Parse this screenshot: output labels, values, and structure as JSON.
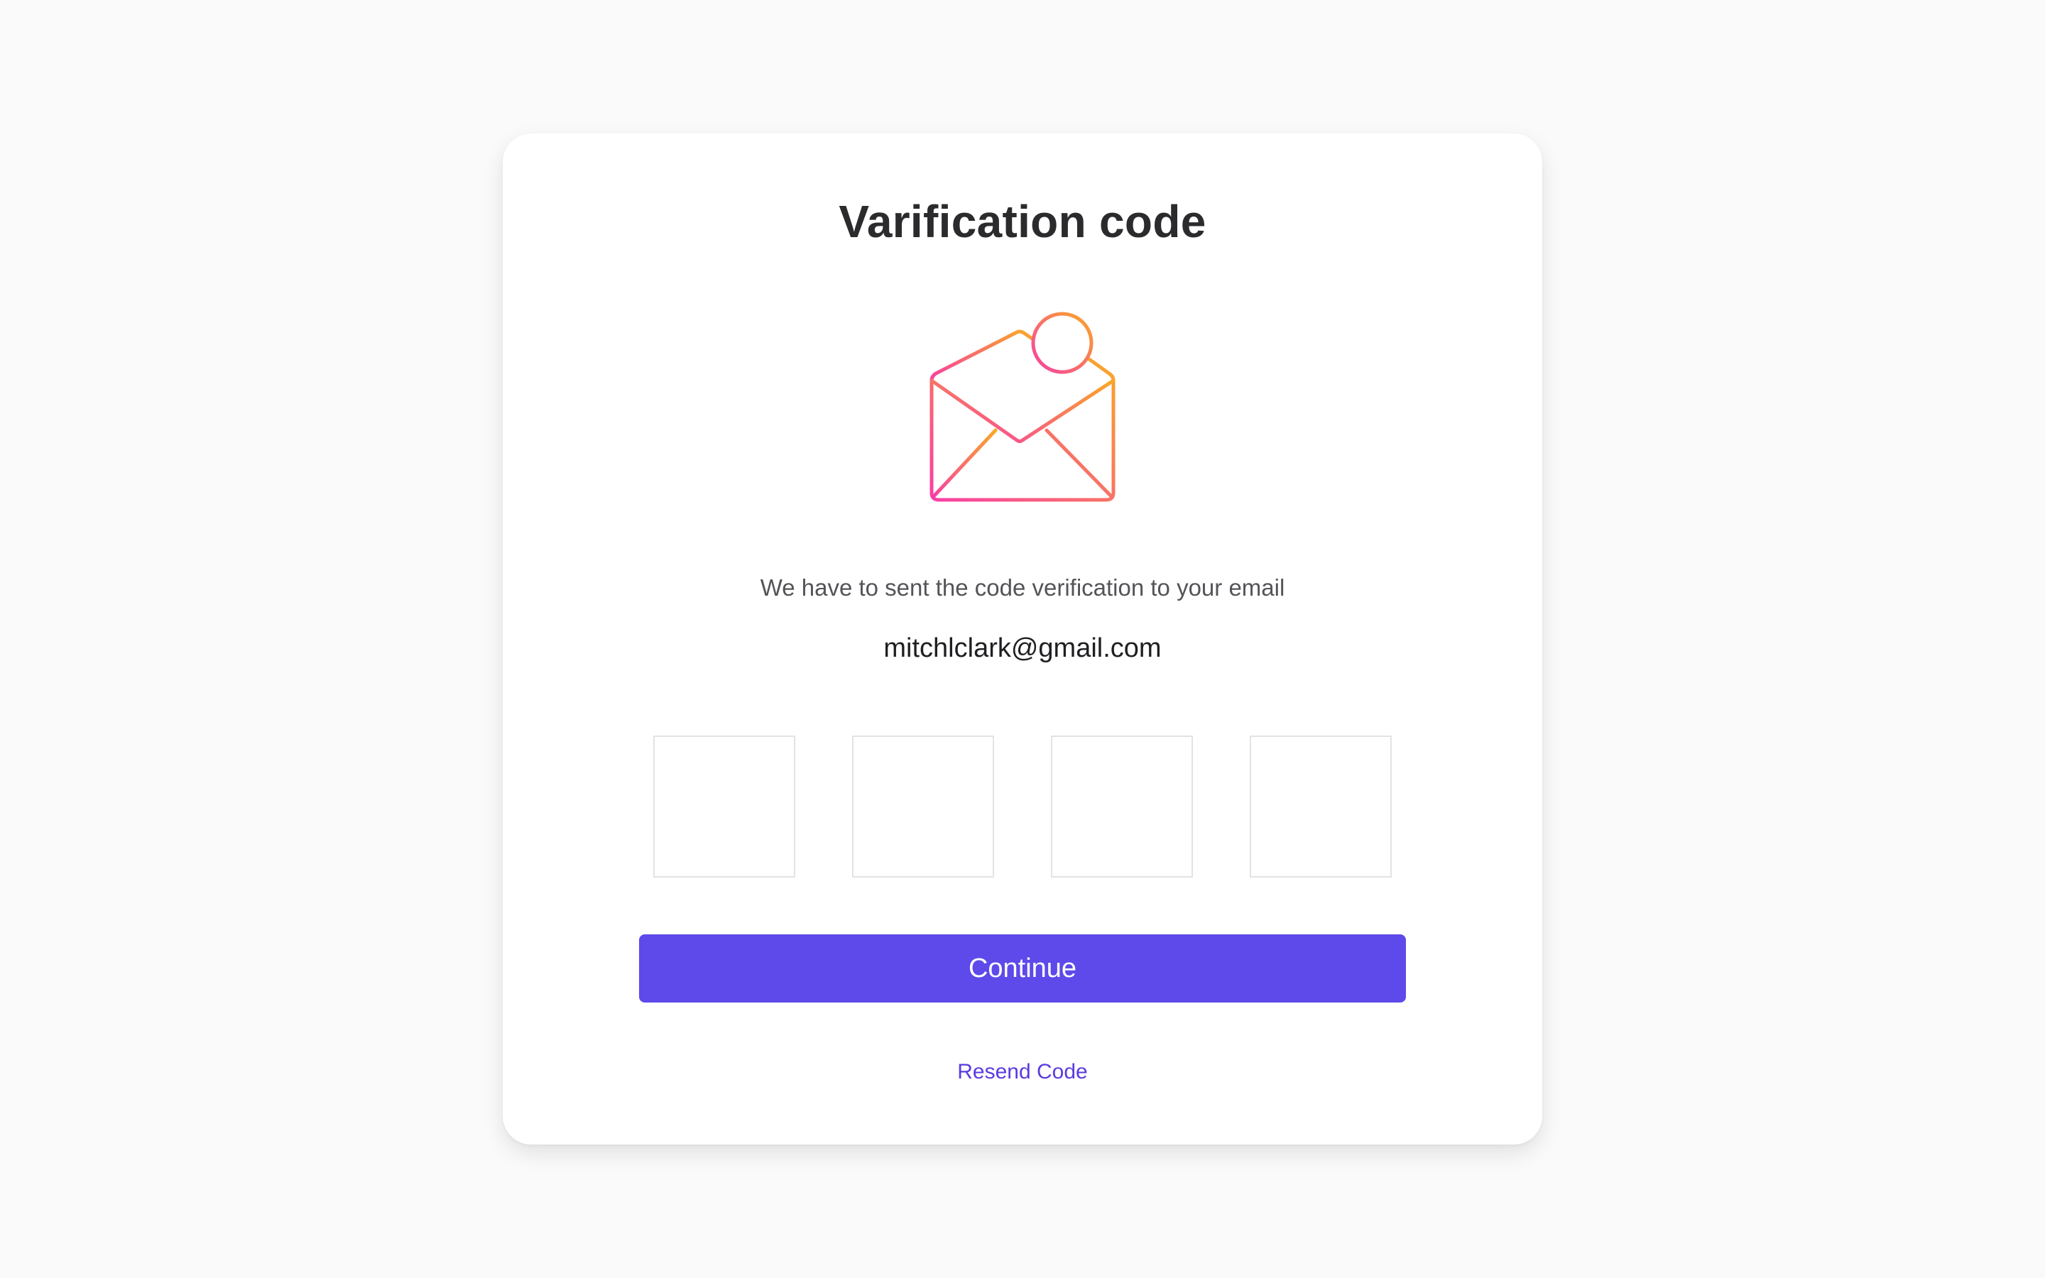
{
  "card": {
    "title": "Varification code",
    "icon": "mail-open-icon",
    "message": "We have to sent the code verification to your email",
    "email": "mitchlclark@gmail.com"
  },
  "code_inputs": [
    {
      "value": ""
    },
    {
      "value": ""
    },
    {
      "value": ""
    },
    {
      "value": ""
    }
  ],
  "actions": {
    "continue_label": "Continue",
    "resend_label": "Resend Code"
  },
  "colors": {
    "accent": "#5e49ea",
    "link": "#5b3be0",
    "icon_gradient_start": "#f83fa5",
    "icon_gradient_end": "#f9a826",
    "background": "#fafafa"
  }
}
